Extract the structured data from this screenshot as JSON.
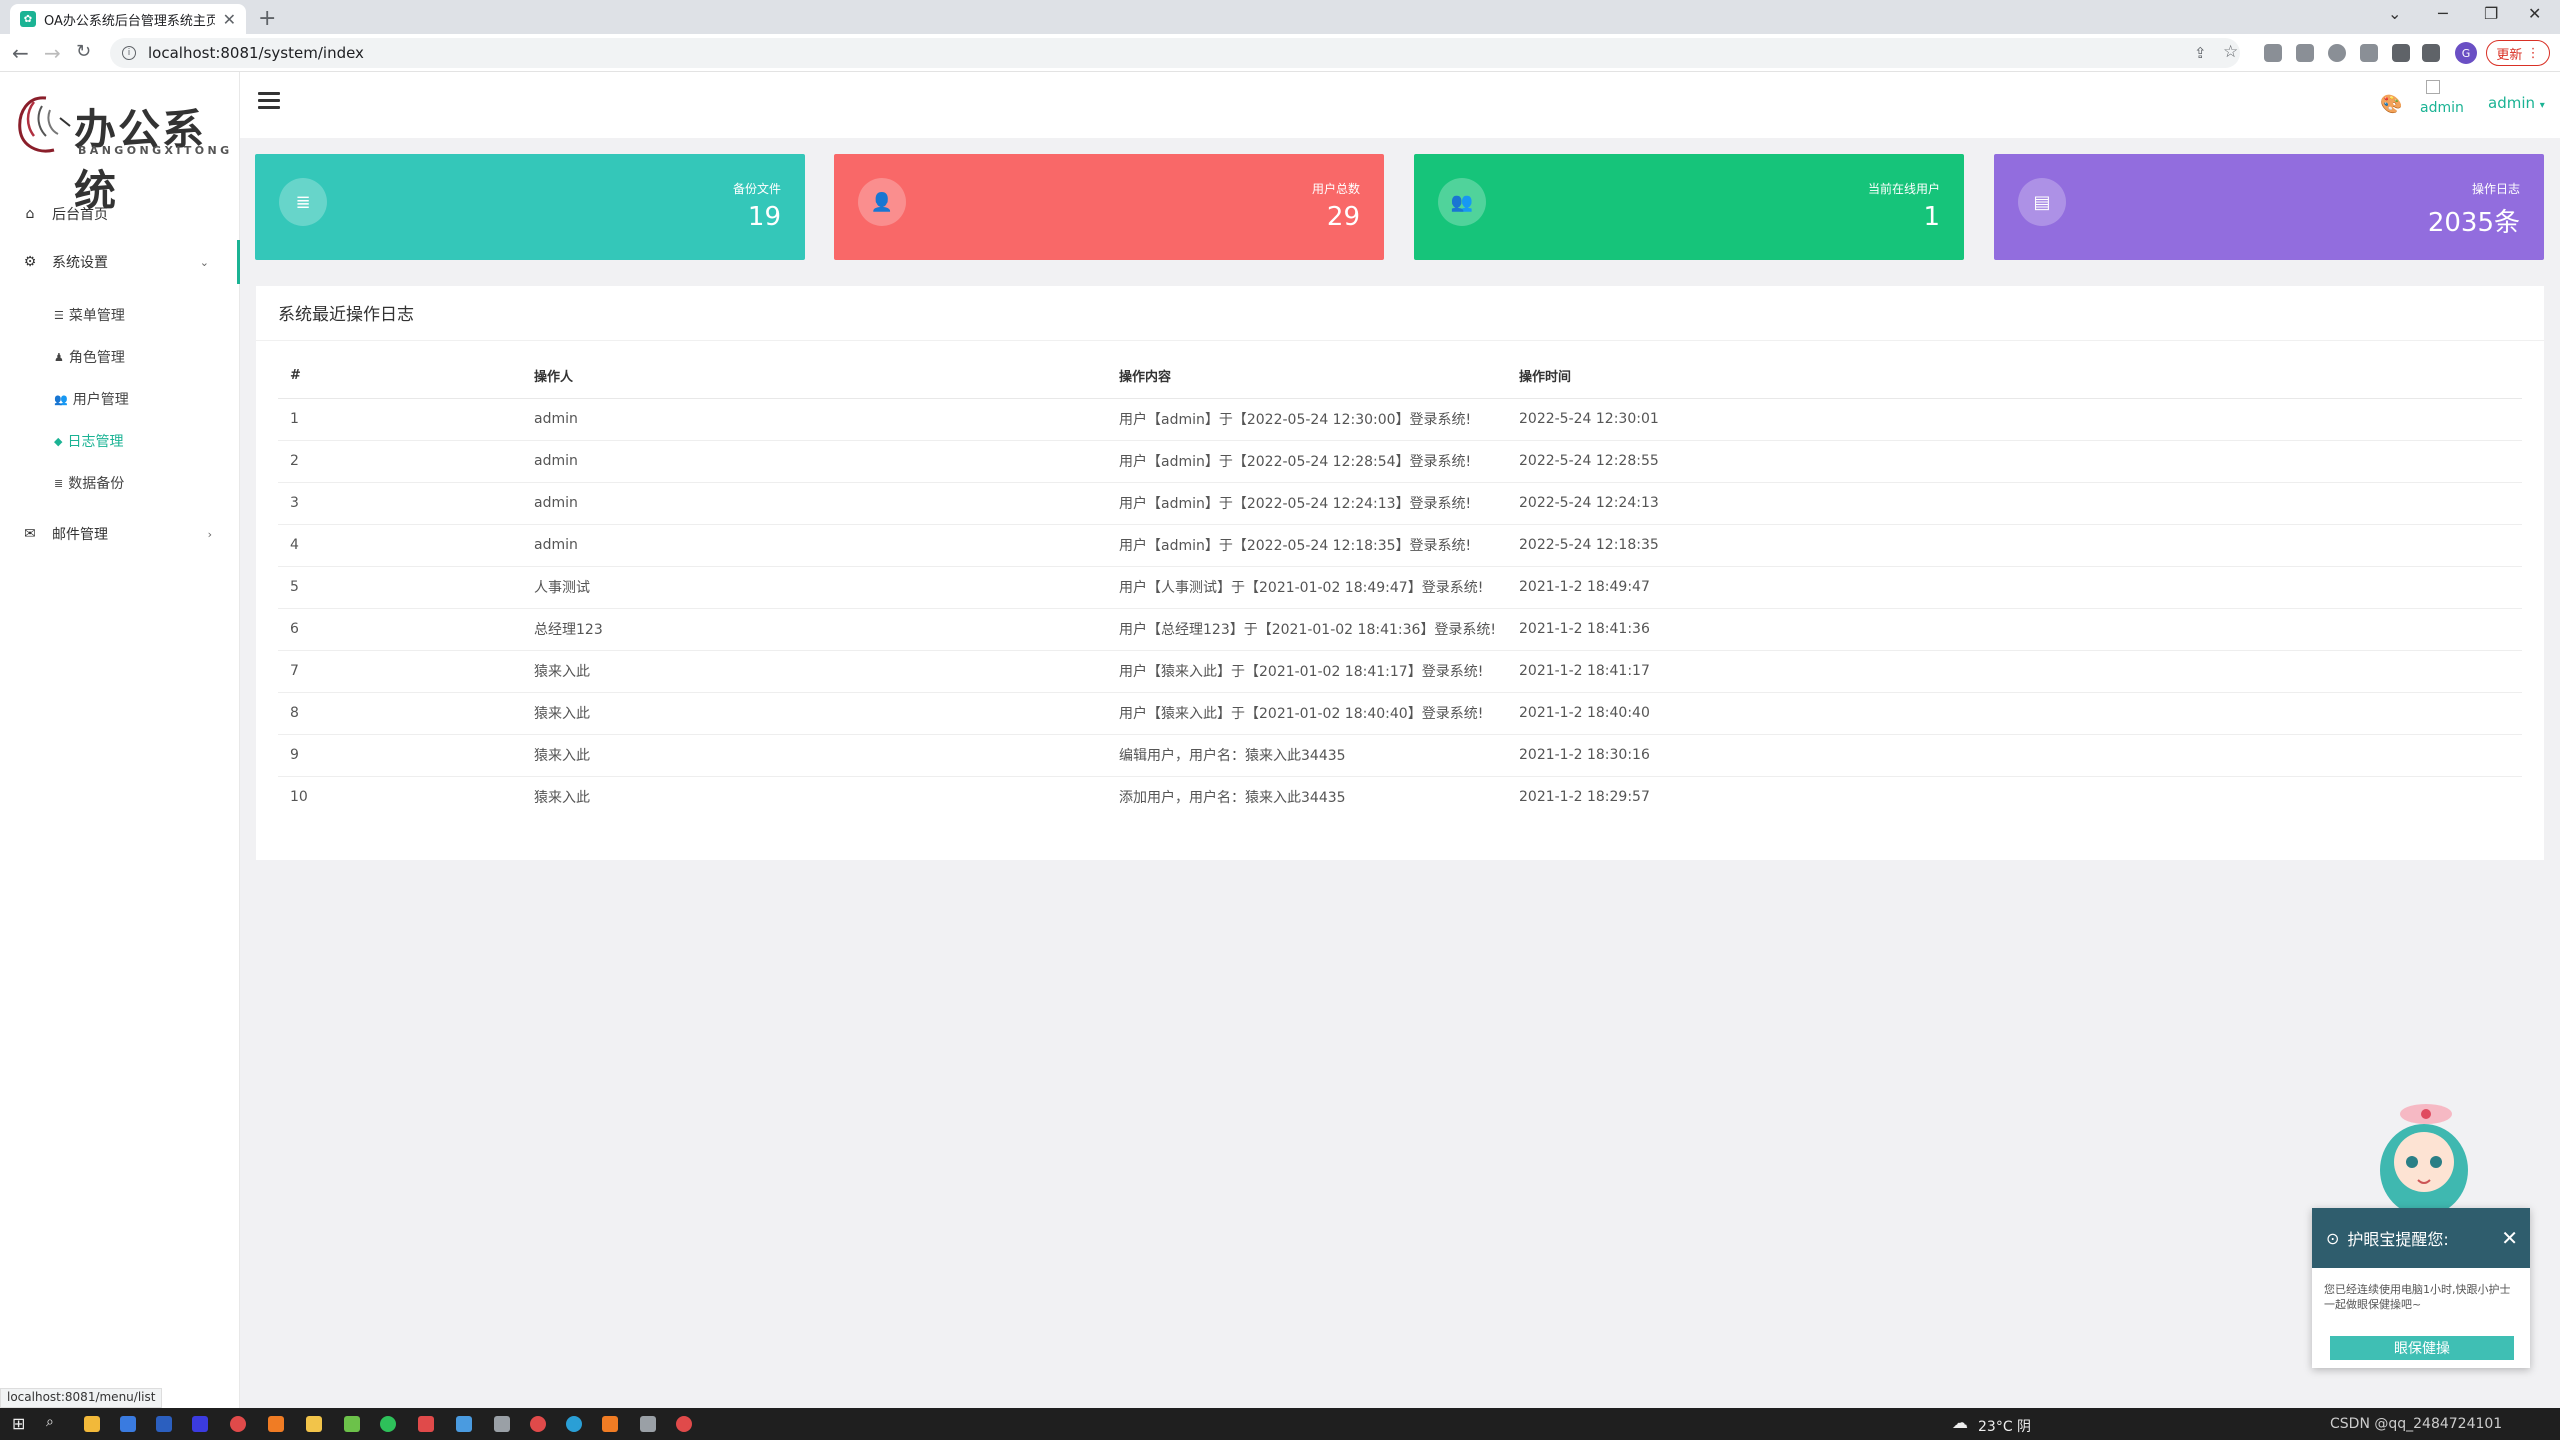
{
  "browser": {
    "tab_title": "OA办公系统后台管理系统主页",
    "url": "localhost:8081/system/index",
    "update_label": "更新",
    "avatar_letter": "G",
    "status_url": "localhost:8081/menu/list"
  },
  "logo": {
    "main": "办公系统",
    "sub": "BANGONGXITONG"
  },
  "sidebar": {
    "items": [
      {
        "label": "后台首页",
        "icon": "home-icon"
      },
      {
        "label": "系统设置",
        "icon": "gear-icon"
      },
      {
        "label": "邮件管理",
        "icon": "envelope-icon"
      }
    ],
    "sub_items": [
      {
        "label": "菜单管理",
        "icon": "list-icon"
      },
      {
        "label": "角色管理",
        "icon": "user-gear-icon"
      },
      {
        "label": "用户管理",
        "icon": "users-icon"
      },
      {
        "label": "日志管理",
        "icon": "tag-icon"
      },
      {
        "label": "数据备份",
        "icon": "database-icon"
      }
    ]
  },
  "header": {
    "user_name": "admin",
    "avatar_alt": "admin"
  },
  "cards": [
    {
      "label": "备份文件",
      "value": "19",
      "color": "#34c7b9",
      "icon": "database-icon"
    },
    {
      "label": "用户总数",
      "value": "29",
      "color": "#f96868",
      "icon": "user-icon"
    },
    {
      "label": "当前在线用户",
      "value": "1",
      "color": "#16c47a",
      "icon": "users-icon"
    },
    {
      "label": "操作日志",
      "value": "2035条",
      "color": "#926dde",
      "icon": "comment-icon"
    }
  ],
  "log": {
    "title": "系统最近操作日志",
    "columns": [
      "#",
      "操作人",
      "操作内容",
      "操作时间"
    ],
    "rows": [
      [
        "1",
        "admin",
        "用户【admin】于【2022-05-24 12:30:00】登录系统!",
        "2022-5-24 12:30:01"
      ],
      [
        "2",
        "admin",
        "用户【admin】于【2022-05-24 12:28:54】登录系统!",
        "2022-5-24 12:28:55"
      ],
      [
        "3",
        "admin",
        "用户【admin】于【2022-05-24 12:24:13】登录系统!",
        "2022-5-24 12:24:13"
      ],
      [
        "4",
        "admin",
        "用户【admin】于【2022-05-24 12:18:35】登录系统!",
        "2022-5-24 12:18:35"
      ],
      [
        "5",
        "人事测试",
        "用户【人事测试】于【2021-01-02 18:49:47】登录系统!",
        "2021-1-2 18:49:47"
      ],
      [
        "6",
        "总经理123",
        "用户【总经理123】于【2021-01-02 18:41:36】登录系统!",
        "2021-1-2 18:41:36"
      ],
      [
        "7",
        "猿来入此",
        "用户【猿来入此】于【2021-01-02 18:41:17】登录系统!",
        "2021-1-2 18:41:17"
      ],
      [
        "8",
        "猿来入此",
        "用户【猿来入此】于【2021-01-02 18:40:40】登录系统!",
        "2021-1-2 18:40:40"
      ],
      [
        "9",
        "猿来入此",
        "编辑用户，用户名：猿来入此34435",
        "2021-1-2 18:30:16"
      ],
      [
        "10",
        "猿来入此",
        "添加用户，用户名：猿来入此34435",
        "2021-1-2 18:29:57"
      ]
    ]
  },
  "popup": {
    "title": "护眼宝提醒您:",
    "message": "您已经连续使用电脑1小时,快跟小护士一起做眼保健操吧~",
    "button": "眼保健操"
  },
  "taskbar": {
    "weather": "23°C 阴",
    "watermark": "CSDN @qq_2484724101"
  }
}
